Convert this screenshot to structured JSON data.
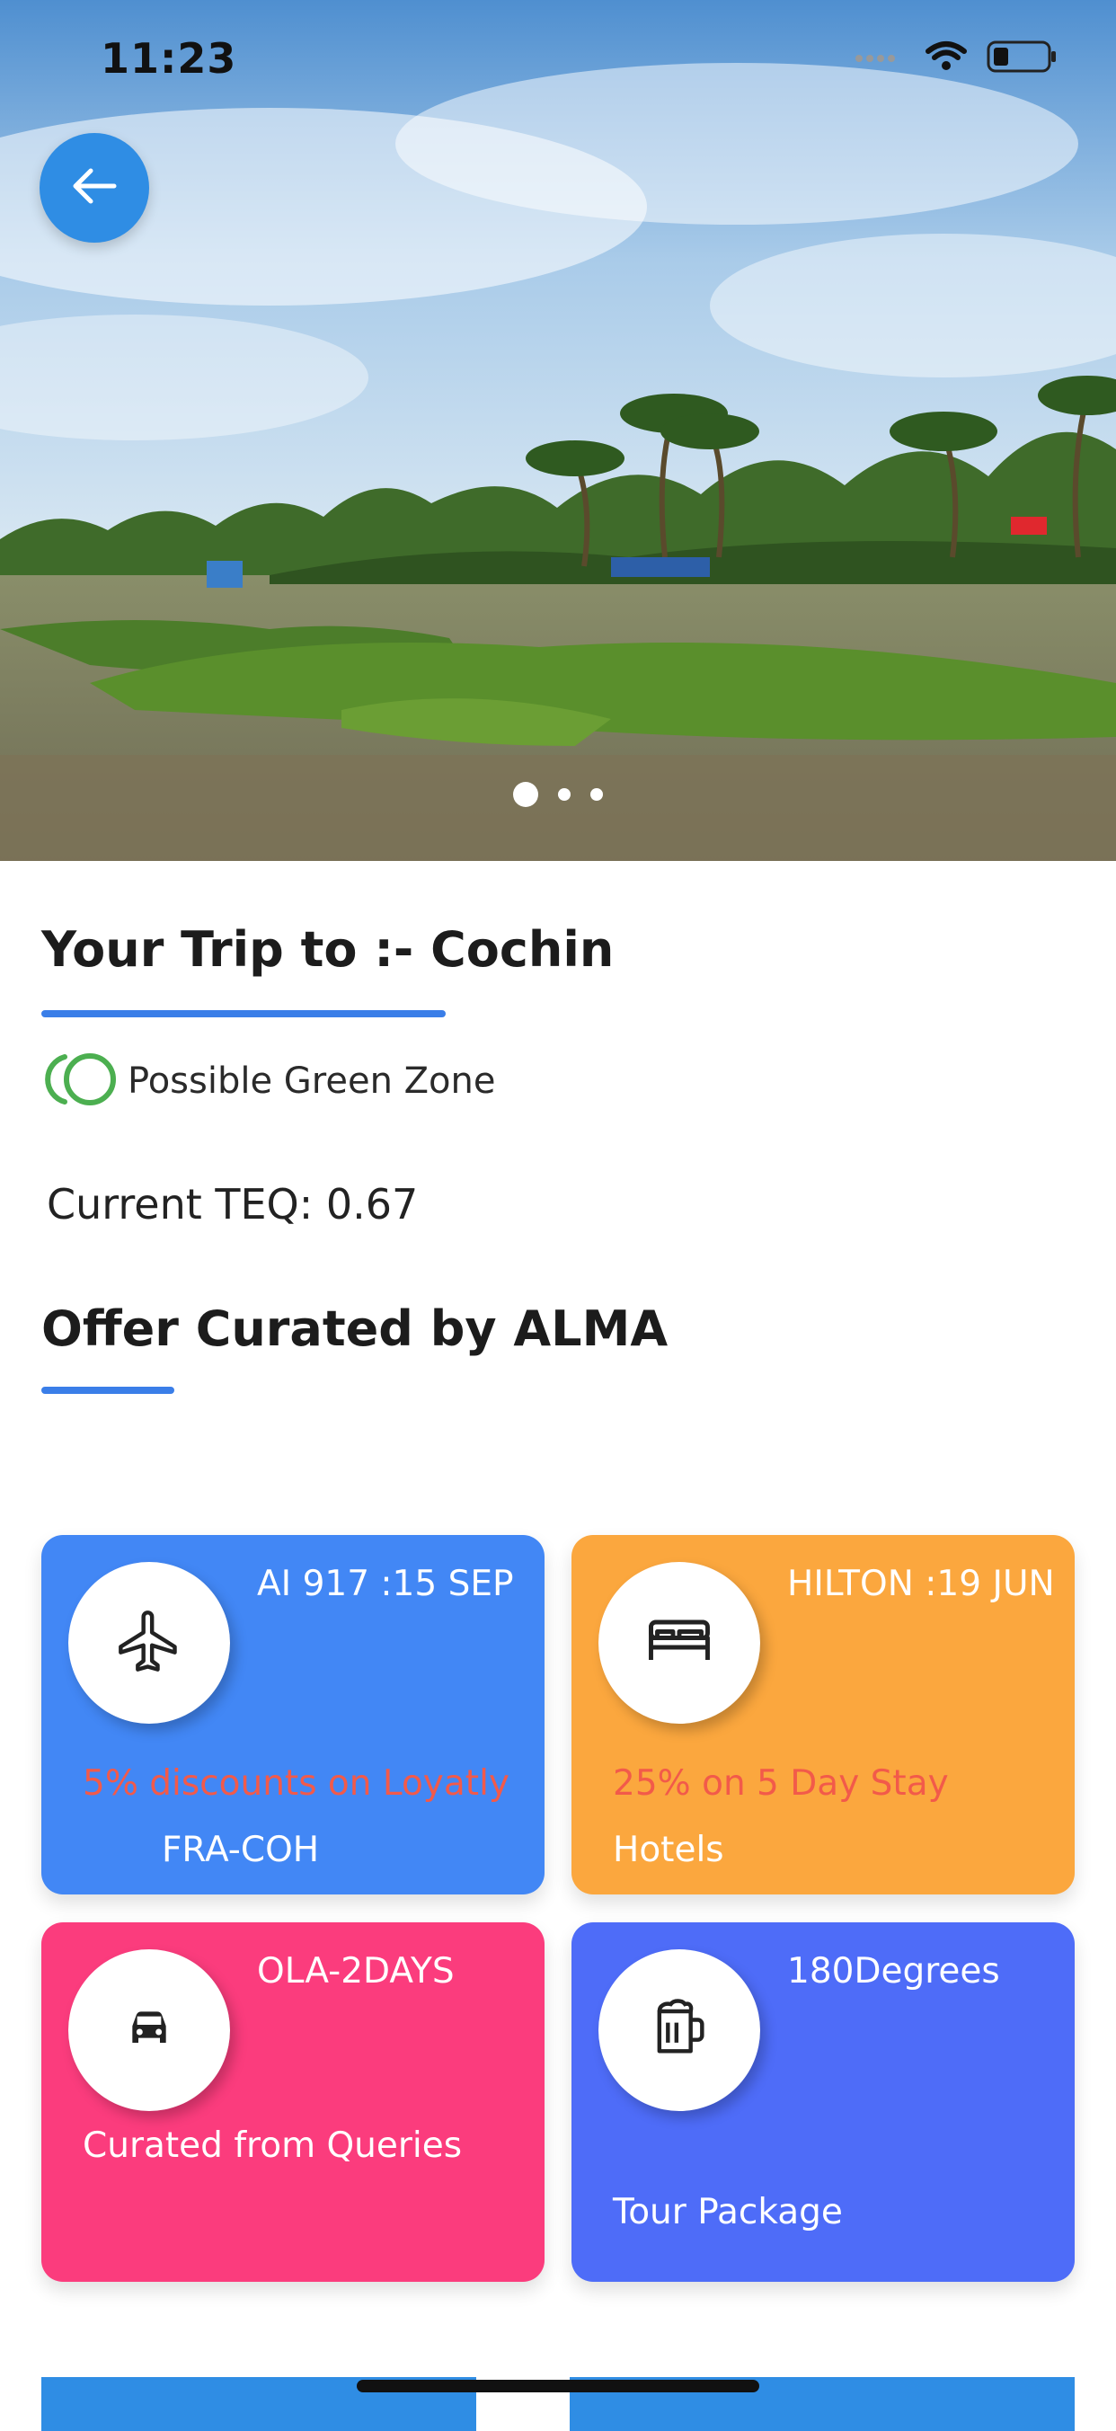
{
  "status_bar": {
    "time": "11:23"
  },
  "trip": {
    "title": "Your Trip to :- Cochin",
    "zone_label": "Possible Green Zone",
    "teq": "Current TEQ: 0.67"
  },
  "offers": {
    "title": "Offer Curated by ALMA",
    "cards": [
      {
        "header": "AI 917 :15 SEP",
        "line1": "5% discounts on Loyatly",
        "line2": "FRA-COH",
        "icon": "airplane-icon",
        "color": "#4287f5",
        "line1_color": "#f25a4a"
      },
      {
        "header": "HILTON :19 JUN",
        "line1": "25% on 5 Day Stay",
        "line2": "Hotels",
        "icon": "bed-icon",
        "color": "#fba73e",
        "line1_color": "#f25a4a"
      },
      {
        "header": "OLA-2DAYS",
        "line1": "Curated from Queries",
        "line2": "",
        "icon": "car-icon",
        "color": "#fb3c7d",
        "line1_color": "#ffffff"
      },
      {
        "header": "180Degrees",
        "line1": "",
        "line2": "Tour Package",
        "icon": "beer-mug-icon",
        "color": "#4e6cf8",
        "line1_color": "#ffffff"
      }
    ]
  },
  "colors": {
    "accent": "#3a7ee8",
    "back_button": "#2f8de4",
    "green_zone": "#4caf50"
  }
}
